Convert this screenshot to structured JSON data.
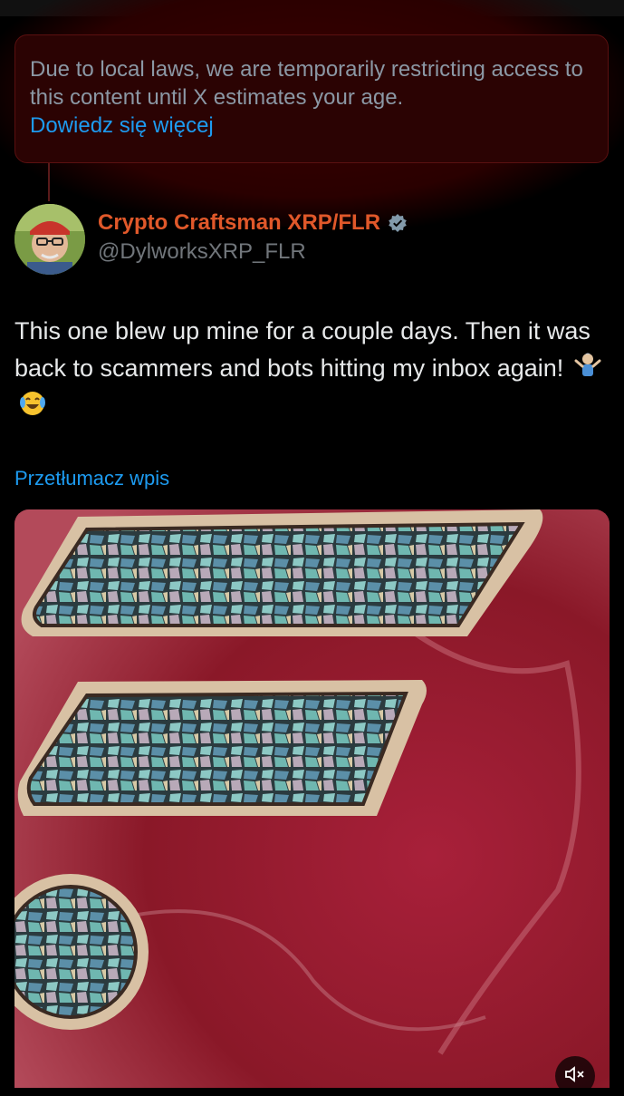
{
  "notice": {
    "text": "Due to local laws, we are temporarily restricting access to this content until X estimates your age.",
    "link_label": "Dowiedz się więcej"
  },
  "tweet": {
    "display_name": "Crypto Craftsman XRP/FLR",
    "handle": "@DylworksXRP_FLR",
    "text": "This one blew up mine for a couple days. Then it was back to scammers and bots hitting my inbox again!",
    "emojis": [
      "man-shrugging-emoji",
      "face-with-tears-of-joy-emoji"
    ],
    "translate_label": "Przetłumacz wpis"
  },
  "media": {
    "icon": "muted-speaker-icon"
  },
  "colors": {
    "background": "#000000",
    "link": "#1d9bf0",
    "name": "#e0582a",
    "secondary": "#71767b",
    "verified": "#829aab"
  }
}
